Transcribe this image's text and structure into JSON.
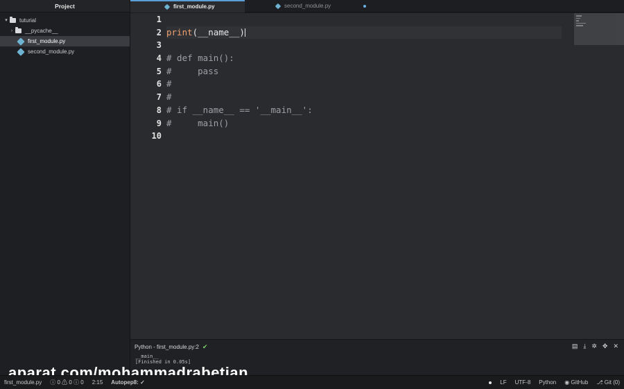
{
  "sidebar": {
    "header": "Project",
    "root": "tuturial",
    "items": [
      {
        "label": "__pycache__",
        "type": "folder"
      },
      {
        "label": "first_module.py",
        "type": "file",
        "selected": true
      },
      {
        "label": "second_module.py",
        "type": "file"
      }
    ]
  },
  "tabs": [
    {
      "label": "first_module.py",
      "active": true
    },
    {
      "label": "second_module.py",
      "active": false,
      "modified": true
    }
  ],
  "editor": {
    "line_numbers": [
      "1",
      "2",
      "3",
      "4",
      "5",
      "6",
      "7",
      "8",
      "9",
      "10"
    ],
    "lines": [
      "",
      "print(__name__)",
      "",
      "# def main():",
      "#     pass",
      "#",
      "#",
      "# if __name__ == '__main__':",
      "#     main()",
      ""
    ],
    "print_kw": "print",
    "print_open": "(",
    "print_arg": "__name__",
    "print_close": ")"
  },
  "panel": {
    "title": "Python - first_module.py:2",
    "output_line1": "__main__",
    "output_line2": "[Finished in 0.05s]"
  },
  "watermark": "aparat.com/mohammadrabetian",
  "statusbar": {
    "file": "first_module.py",
    "diagnostics": "ⓘ 0 ⚠ 0 ⓘ 0",
    "position": "2:15",
    "autopep": "Autopep8: ✓",
    "line_ending": "LF",
    "encoding": "UTF-8",
    "grammar": "Python",
    "github": "GitHub",
    "git": "Git (0)"
  },
  "colors": {
    "accent": "#5b9fd6",
    "keyword": "#f0a06f",
    "comment": "#9da0a6",
    "success": "#7dd56a"
  }
}
